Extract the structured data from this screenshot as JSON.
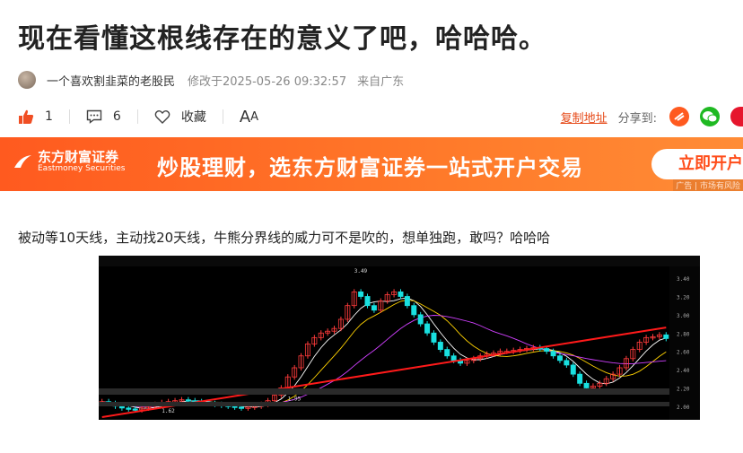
{
  "article": {
    "title": "现在看懂这根线存在的意义了吧，哈哈哈。",
    "author": "一个喜欢割韭菜的老股民",
    "modified": "修改于2025-05-26 09:32:57",
    "location": "来自广东",
    "paragraph": "被动等10天线，主动找20天线，牛熊分界线的威力可不是吹的，想单独跑，敢吗？哈哈哈"
  },
  "actions": {
    "like_count": "1",
    "comment_count": "6",
    "favorite_label": "收藏",
    "font_label": "A",
    "font_label_small": "A",
    "copy_link": "复制地址",
    "share_label": "分享到:"
  },
  "banner": {
    "brand_cn": "东方财富证券",
    "brand_en": "Eastmoney Securities",
    "slogan": "炒股理财，选东方财富证券一站式开户交易",
    "cta": "立即开户",
    "ad_tag": "广告 | 市场有风险"
  },
  "colors": {
    "accent": "#ff5a1f",
    "link": "#e64a19",
    "like": "#f04e23",
    "up_candle": "#ff3b3b",
    "down_candle": "#19e0e0",
    "trend_line": "#ff1a1a"
  },
  "chart_data": {
    "type": "candlestick",
    "title": "",
    "xlabel": "",
    "ylabel": "",
    "ylim": [
      1.9,
      3.45
    ],
    "y_ticks": [
      "3.40",
      "3.20",
      "3.00",
      "2.80",
      "2.60",
      "2.40",
      "2.20",
      "2.00"
    ],
    "annotations": [
      "3.49",
      "1.62",
      "1.95"
    ],
    "closes": [
      2.05,
      2.03,
      2.0,
      1.98,
      1.97,
      1.96,
      1.98,
      2.0,
      2.02,
      2.04,
      2.05,
      2.06,
      2.07,
      2.06,
      2.05,
      2.04,
      2.03,
      2.02,
      2.01,
      2.0,
      1.99,
      1.98,
      1.99,
      2.0,
      2.02,
      2.06,
      2.12,
      2.2,
      2.32,
      2.42,
      2.55,
      2.68,
      2.75,
      2.8,
      2.82,
      2.85,
      2.95,
      3.1,
      3.25,
      3.2,
      3.1,
      3.05,
      3.15,
      3.22,
      3.25,
      3.2,
      3.1,
      3.0,
      2.9,
      2.8,
      2.7,
      2.62,
      2.55,
      2.5,
      2.47,
      2.5,
      2.52,
      2.55,
      2.57,
      2.58,
      2.6,
      2.6,
      2.61,
      2.62,
      2.63,
      2.64,
      2.63,
      2.6,
      2.55,
      2.5,
      2.45,
      2.35,
      2.25,
      2.2,
      2.22,
      2.25,
      2.3,
      2.35,
      2.42,
      2.52,
      2.62,
      2.7,
      2.75,
      2.76,
      2.78,
      2.74
    ],
    "trend_line": {
      "from": [
        0,
        1.88
      ],
      "to": [
        85,
        2.86
      ]
    }
  }
}
